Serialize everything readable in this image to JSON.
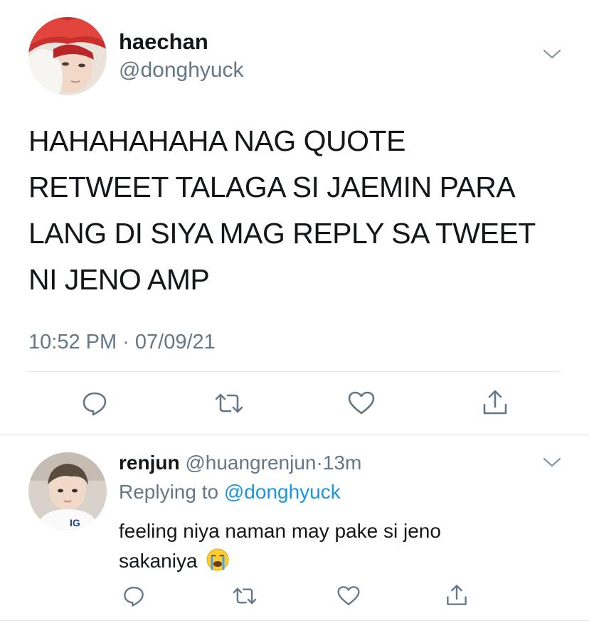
{
  "main_tweet": {
    "author_name": "haechan",
    "author_handle": "@donghyuck",
    "avatar_icon": "user-avatar-red-hair",
    "text_lines": [
      "HAHAHAHAHA NAG QUOTE",
      "RETWEET TALAGA SI JAEMIN PARA",
      "LANG DI SIYA MAG REPLY SA TWEET",
      "NI JENO AMP"
    ],
    "timestamp": "10:52 PM · 07/09/21",
    "menu_icon": "chevron-down-icon",
    "actions": [
      "reply-icon",
      "retweet-icon",
      "like-icon",
      "share-icon"
    ]
  },
  "reply_tweet": {
    "author_name": "renjun",
    "author_handle": "@huangrenjun",
    "separator": "·",
    "time_ago": "13m",
    "replying_to_label": "Replying to",
    "replying_to_handle": "@donghyuck",
    "text_line1": "feeling niya naman may pake si jeno",
    "text_line2": "sakaniya",
    "emoji": "😭",
    "avatar_icon": "user-avatar-white-shirt",
    "menu_icon": "chevron-down-icon",
    "actions": [
      "reply-icon",
      "retweet-icon",
      "like-icon",
      "share-icon"
    ]
  },
  "colors": {
    "text": "#14171a",
    "muted": "#657786",
    "link": "#1b95e0",
    "divider": "#e1e8ed"
  }
}
